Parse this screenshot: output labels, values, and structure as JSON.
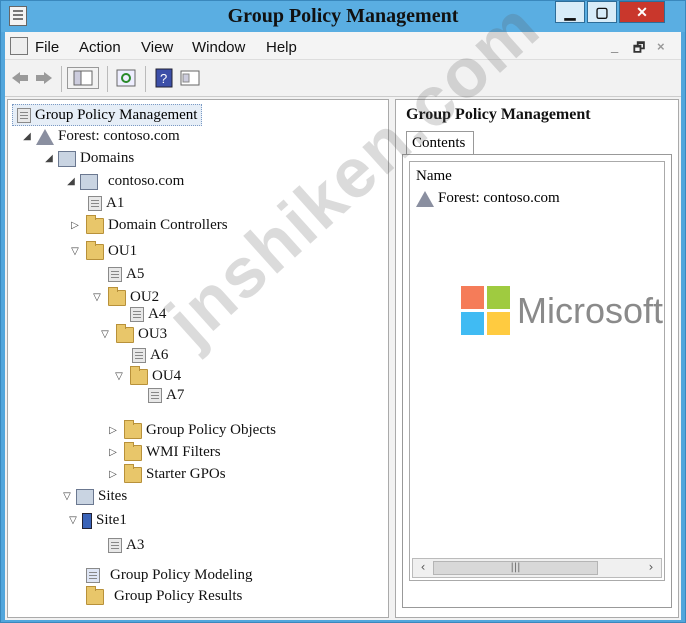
{
  "window": {
    "title": "Group Policy Management"
  },
  "menu": {
    "items": [
      "File",
      "Action",
      "View",
      "Window",
      "Help"
    ]
  },
  "mdi_controls": {
    "minimize": "_",
    "restore": "🗗",
    "close": "×"
  },
  "tree": {
    "root": "Group Policy Management",
    "forest": "Forest: contoso.com",
    "domains": "Domains",
    "domain": "contoso.com",
    "a1": "A1",
    "domain_controllers": "Domain Controllers",
    "ou1": "OU1",
    "a5": "A5",
    "ou2": "OU2",
    "a4": "A4",
    "ou3": "OU3",
    "a6": "A6",
    "ou4": "OU4",
    "a7": "A7",
    "gpo": "Group Policy Objects",
    "wmi": "WMI Filters",
    "starter": "Starter GPOs",
    "sites": "Sites",
    "site1": "Site1",
    "a3": "A3",
    "modeling": "Group Policy Modeling",
    "results": "Group Policy Results"
  },
  "right": {
    "title": "Group Policy Management",
    "tab": "Contents",
    "column": "Name",
    "row": "Forest: contoso.com"
  },
  "overlay": {
    "brand": "Microsoft",
    "watermark": "jnshiken.com"
  },
  "colors": {
    "ms_red": "#f25022",
    "ms_green": "#7fba00",
    "ms_blue": "#00a4ef",
    "ms_yellow": "#ffb900"
  }
}
